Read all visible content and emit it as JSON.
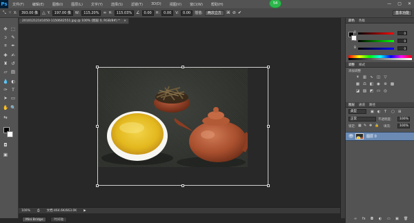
{
  "app": {
    "logo": "Ps"
  },
  "menu": [
    "文件(F)",
    "编辑(E)",
    "图像(I)",
    "图层(L)",
    "文字(Y)",
    "选择(S)",
    "滤镜(T)",
    "3D(D)",
    "视图(V)",
    "窗口(W)",
    "帮助(H)"
  ],
  "green_badge": "54",
  "window_controls": [
    "—",
    "▢",
    "✕"
  ],
  "options_bar": {
    "x_label": "X:",
    "x_value": "393.00 像",
    "y_label": "Y:",
    "y_value": "197.00 像",
    "w_label": "W:",
    "w_value": "115.20%",
    "h_label": "H:",
    "h_value": "115.03%",
    "angle_value": "0.00",
    "hskew_label": "H:",
    "hskew_value": "0.00",
    "vskew_label": "V:",
    "vskew_value": "0.00",
    "interp_label": "插值:",
    "interp_value": "两次立方",
    "workspace": "基本功能"
  },
  "document_tab": {
    "title": "20101212141050-1150642551.jpg @ 100% (图层 0, RGB/8#) *",
    "close": "×"
  },
  "status_bar": {
    "zoom": "100%",
    "doc_info": "文档:464.6K/663.0K"
  },
  "bottom_tabs": [
    "Mini Bridge",
    "时间轴"
  ],
  "panels": {
    "color_tabs": [
      "颜色",
      "色板"
    ],
    "rgb": [
      {
        "label": "R",
        "value": "0"
      },
      {
        "label": "G",
        "value": "0"
      },
      {
        "label": "B",
        "value": "0"
      }
    ],
    "adjust_tabs": [
      "调整",
      "样式"
    ],
    "adjust_hint": "添加调整",
    "layers_tabs": [
      "图层",
      "通道",
      "路径"
    ],
    "kind": "类型",
    "blend_mode": "正常",
    "opacity_label": "不透明度:",
    "opacity_value": "100%",
    "lock_label": "锁定:",
    "fill_label": "填充:",
    "fill_value": "100%",
    "layer_name": "图层 0"
  },
  "colors": {
    "accent": "#6b8bb5",
    "bg": "#282828"
  }
}
